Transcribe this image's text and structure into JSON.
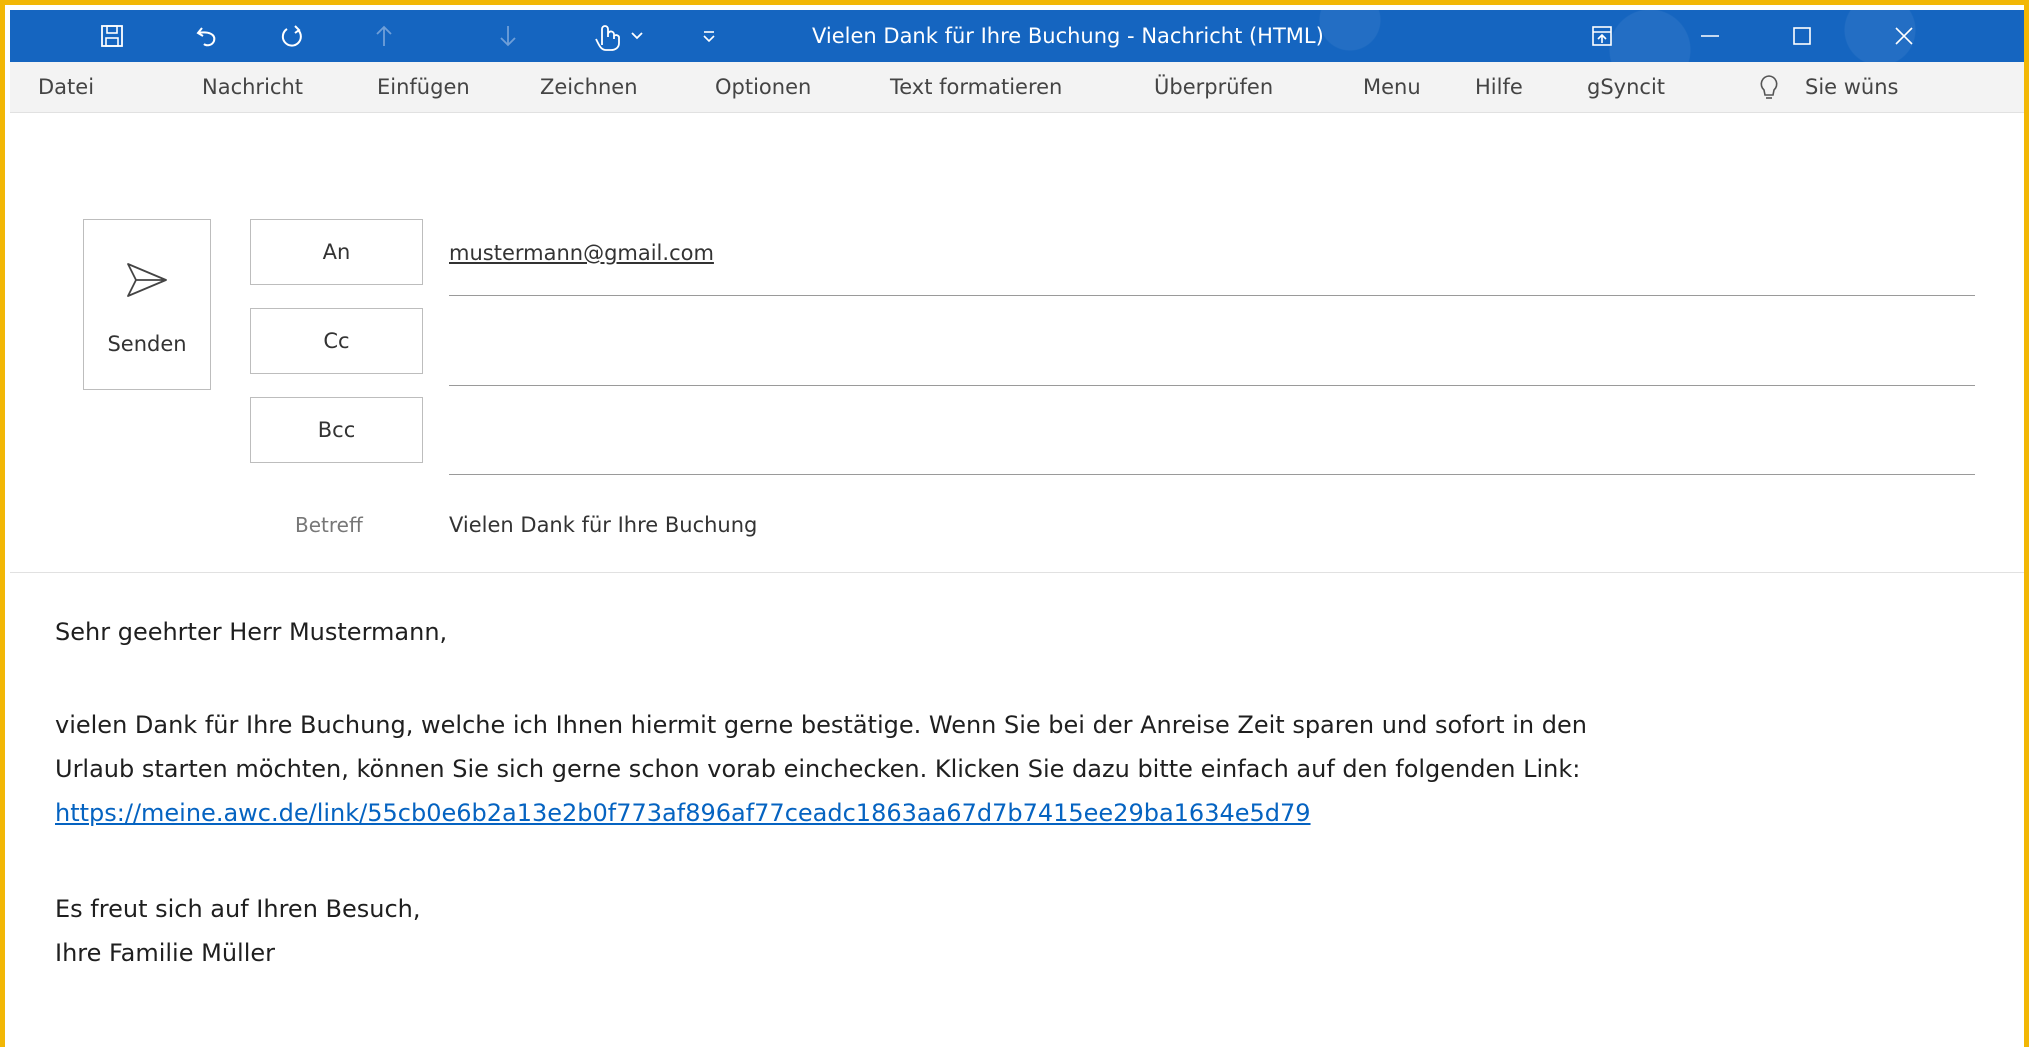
{
  "titlebar": {
    "title": "Vielen Dank für Ihre Buchung  -  Nachricht (HTML)",
    "icons": [
      "save-icon",
      "undo-icon",
      "redo-icon",
      "up-arrow-icon",
      "down-arrow-icon",
      "touch-mode-icon",
      "customize-qat-icon",
      "ribbon-display-icon",
      "minimize-icon",
      "maximize-icon",
      "close-icon"
    ],
    "bg_color": "#1565c0"
  },
  "menu": {
    "items": [
      "Datei",
      "Nachricht",
      "Einfügen",
      "Zeichnen",
      "Optionen",
      "Text formatieren",
      "Überprüfen",
      "Menu",
      "Hilfe",
      "gSyncit"
    ],
    "tell_me": "Sie wüns"
  },
  "compose": {
    "send_label": "Senden",
    "to_label": "An",
    "cc_label": "Cc",
    "bcc_label": "Bcc",
    "to_value": "mustermann@gmail.com",
    "cc_value": "",
    "bcc_value": "",
    "subject_label": "Betreff",
    "subject_value": "Vielen Dank für Ihre Buchung"
  },
  "body": {
    "greeting": "Sehr geehrter Herr Mustermann,",
    "line1": "vielen Dank für Ihre Buchung, welche ich Ihnen hiermit gerne bestätige. Wenn Sie bei der Anreise Zeit sparen und sofort in den",
    "line2": "Urlaub starten möchten, können Sie sich gerne schon vorab einchecken. Klicken Sie dazu bitte einfach auf den folgenden Link:",
    "link": "https://meine.awc.de/link/55cb0e6b2a13e2b0f773af896af77ceadc1863aa67d7b7415ee29ba1634e5d79",
    "closing": "Es freut sich auf Ihren Besuch,",
    "signature": "Ihre Familie Müller"
  },
  "colors": {
    "frame": "#f2b705",
    "link": "#0563c1"
  }
}
